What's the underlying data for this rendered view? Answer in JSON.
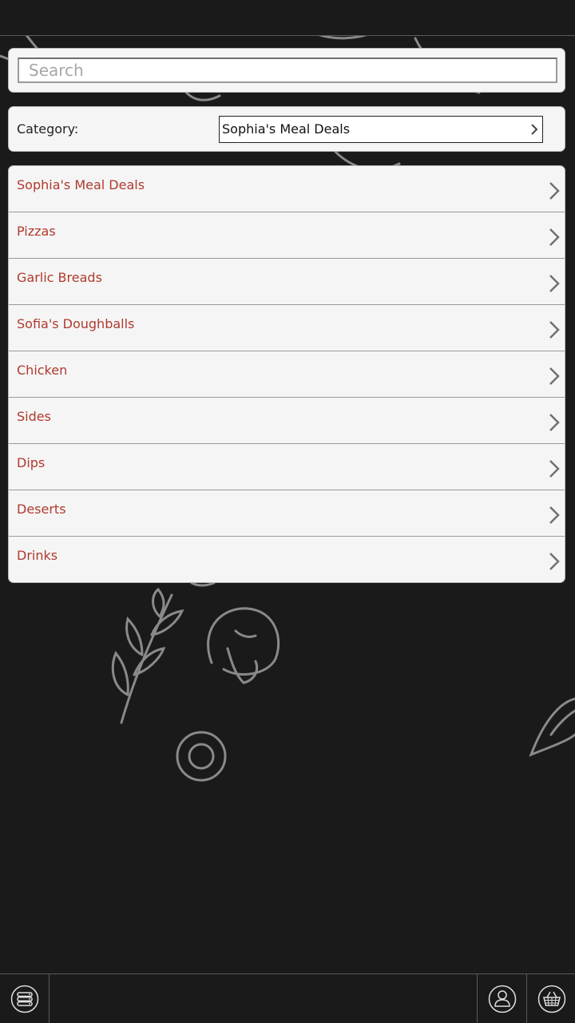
{
  "search": {
    "placeholder": "Search",
    "value": ""
  },
  "category": {
    "label": "Category:",
    "selected": "Sophia's Meal Deals"
  },
  "menu_items": [
    {
      "label": "Sophia's Meal Deals"
    },
    {
      "label": "Pizzas"
    },
    {
      "label": "Garlic Breads"
    },
    {
      "label": "Sofia's Doughballs"
    },
    {
      "label": "Chicken"
    },
    {
      "label": "Sides"
    },
    {
      "label": "Dips"
    },
    {
      "label": "Deserts"
    },
    {
      "label": "Drinks"
    }
  ],
  "bottom_nav": {
    "menu_icon": "list-icon",
    "account_icon": "user-icon",
    "basket_icon": "basket-icon"
  },
  "colors": {
    "background": "#1a1a1a",
    "panel": "#f5f5f5",
    "item_text": "#b03a2e"
  }
}
